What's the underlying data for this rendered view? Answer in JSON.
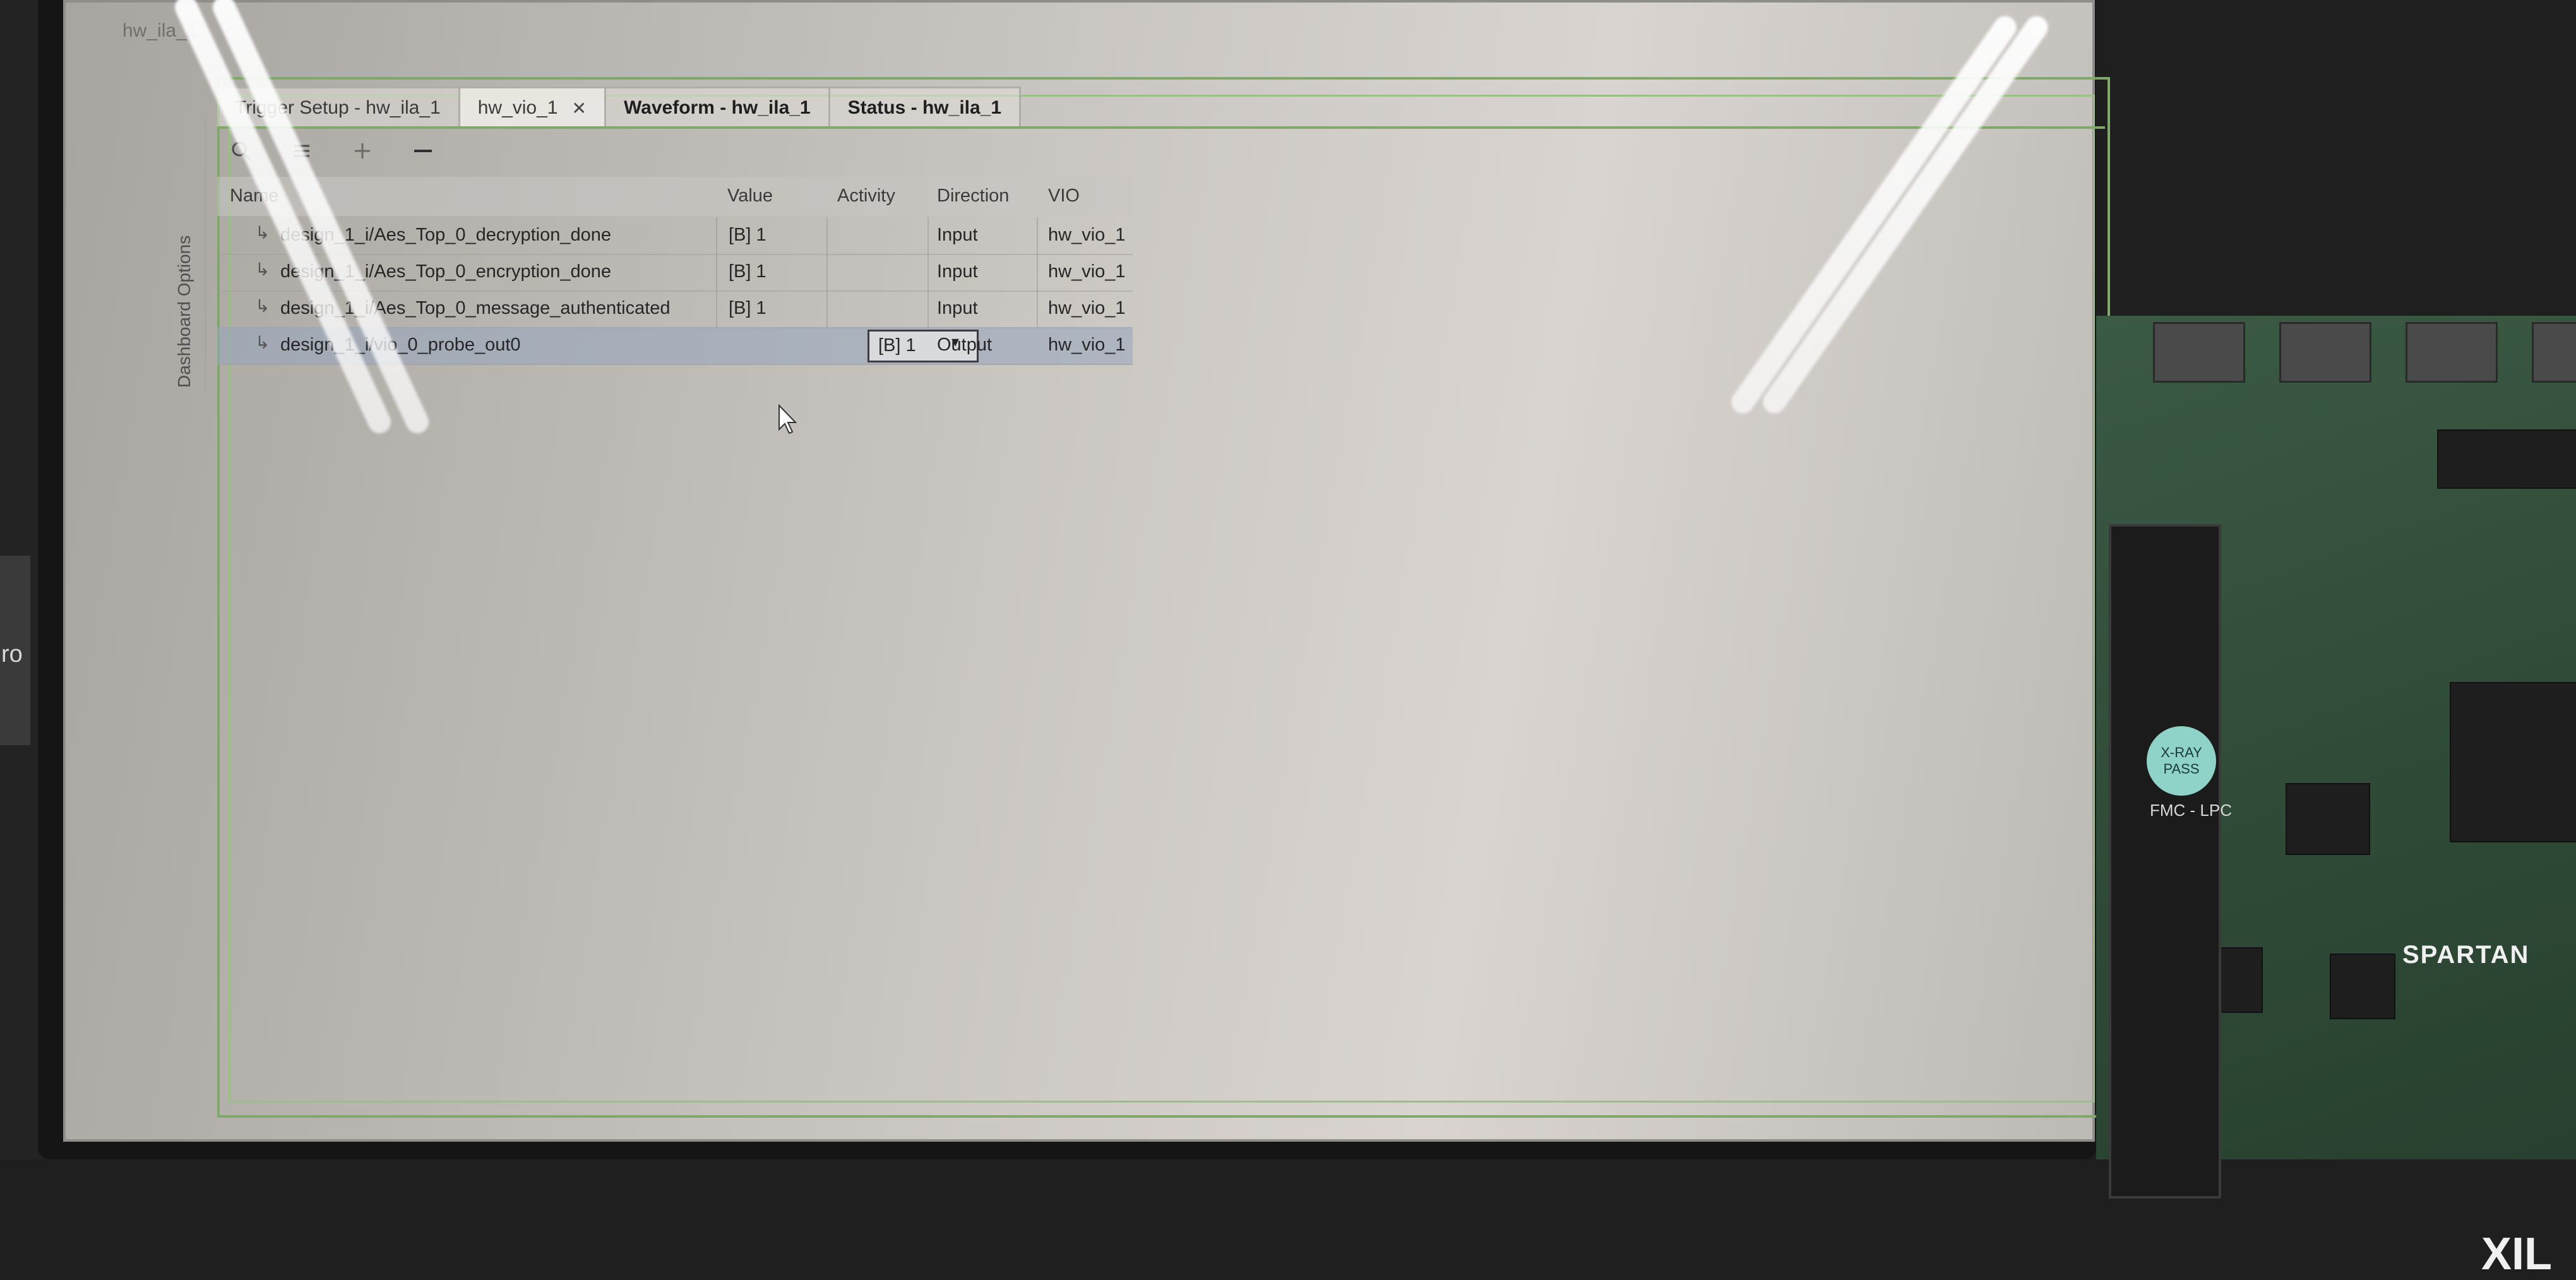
{
  "window": {
    "title": "hw_ila_1"
  },
  "sidebar": {
    "label": "Dashboard Options"
  },
  "tabs": [
    {
      "label": "Trigger Setup - hw_ila_1",
      "bold": false,
      "closable": false
    },
    {
      "label": "hw_vio_1",
      "bold": false,
      "closable": true,
      "active": true
    },
    {
      "label": "Waveform - hw_ila_1",
      "bold": true,
      "closable": false
    },
    {
      "label": "Status - hw_ila_1",
      "bold": true,
      "closable": false
    }
  ],
  "toolbar": {
    "search_icon": "search-icon",
    "collapse_icon": "collapse-all-icon",
    "add_icon": "plus-icon",
    "remove_icon": "minus-icon"
  },
  "table": {
    "headers": {
      "name": "Name",
      "value": "Value",
      "activity": "Activity",
      "direction": "Direction",
      "vio": "VIO"
    },
    "rows": [
      {
        "name": "design_1_i/Aes_Top_0_decryption_done",
        "value": "[B] 1",
        "activity": "",
        "direction": "Input",
        "vio": "hw_vio_1"
      },
      {
        "name": "design_1_i/Aes_Top_0_encryption_done",
        "value": "[B] 1",
        "activity": "",
        "direction": "Input",
        "vio": "hw_vio_1"
      },
      {
        "name": "design_1_i/Aes_Top_0_message_authenticated",
        "value": "[B] 1",
        "activity": "",
        "direction": "Input",
        "vio": "hw_vio_1"
      },
      {
        "name": "design_1_i/vio_0_probe_out0",
        "value": "[B] 1",
        "activity": "",
        "direction": "Output",
        "vio": "hw_vio_1"
      }
    ]
  },
  "board": {
    "brand": "SPARTAN",
    "vendor_partial": "XIL",
    "badge": "X-RAY\nPASS",
    "connector_label": "FMC - LPC"
  },
  "left_device": {
    "text": "ro"
  },
  "colors": {
    "accent_green": "#7fa86a",
    "selected_row": "#96a5be"
  }
}
